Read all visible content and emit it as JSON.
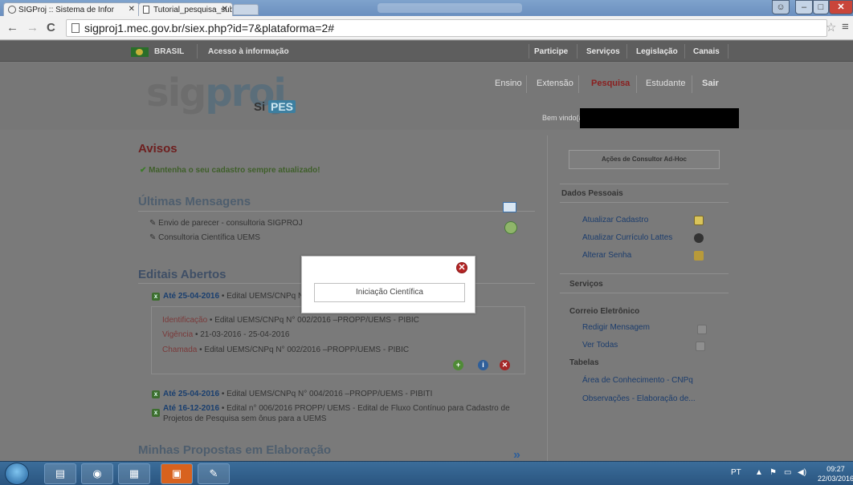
{
  "browser": {
    "tabs": [
      {
        "label": "SIGProj :: Sistema de Infor"
      },
      {
        "label": "Tutorial_pesquisa_submi"
      }
    ],
    "url": "sigproj1.mec.gov.br/siex.php?id=7&plataforma=2#"
  },
  "gov_bar": {
    "brasil": "BRASIL",
    "acesso": "Acesso à informação",
    "links": [
      "Participe",
      "Serviços",
      "Legislação",
      "Canais"
    ]
  },
  "header": {
    "logo_prefix": "sig",
    "logo_mid": "proj",
    "si": "Si",
    "pes": "PES",
    "nav": [
      "Ensino",
      "Extensão",
      "Pesquisa",
      "Estudante",
      "Sair"
    ],
    "active_nav": "Pesquisa",
    "welcome": "Bem vindo(a)"
  },
  "avisos": {
    "title": "Avisos",
    "item": "Mantenha o seu cadastro sempre atualizado!"
  },
  "mensagens": {
    "title": "Últimas Mensagens",
    "items": [
      "Envio de parecer - consultoria SIGPROJ",
      "Consultoria Científica UEMS"
    ]
  },
  "editais": {
    "title": "Editais Abertos",
    "items": [
      {
        "deadline": "Até 25-04-2016",
        "text": " • Edital UEMS/CNPq N° 002/2016 –PROPP/UEMS - PIBIC"
      },
      {
        "deadline": "Até 25-04-2016",
        "text": " • Edital UEMS/CNPq N° 004/2016 –PROPP/UEMS - PIBITI"
      },
      {
        "deadline": "Até 16-12-2016",
        "text": " • Edital n° 006/2016 PROPP/ UEMS - Edital de Fluxo Contínuo para Cadastro de",
        "text2": "Projetos de Pesquisa sem ônus para a UEMS"
      }
    ],
    "detail": {
      "ident_label": "Identificação",
      "ident_value": " • Edital UEMS/CNPq N° 002/2016 –PROPP/UEMS - PIBIC",
      "vig_label": "Vigência",
      "vig_value": " • 21-03-2016 - 25-04-2016",
      "cham_label": "Chamada",
      "cham_value": " • Edital UEMS/CNPq N° 002/2016 –PROPP/UEMS -  PIBIC"
    }
  },
  "propostas": {
    "title": "Minhas Propostas em Elaboração"
  },
  "sidebar": {
    "consultor_button": "Ações de Consultor Ad-Hoc",
    "dados_title": "Dados Pessoais",
    "dados_links": [
      "Atualizar Cadastro",
      "Atualizar Currículo Lattes",
      "Alterar Senha"
    ],
    "servicos_title": "Serviços",
    "correio_title": "Correio Eletrônico",
    "correio_links": [
      "Redigir Mensagem",
      "Ver Todas"
    ],
    "tabelas_title": "Tabelas",
    "tabelas_links": [
      "Área de Conhecimento - CNPq",
      "Observações - Elaboração de..."
    ]
  },
  "modal": {
    "button": "Iniciação Científica"
  },
  "taskbar": {
    "lang": "PT",
    "time": "09:27",
    "date": "22/03/2016"
  }
}
